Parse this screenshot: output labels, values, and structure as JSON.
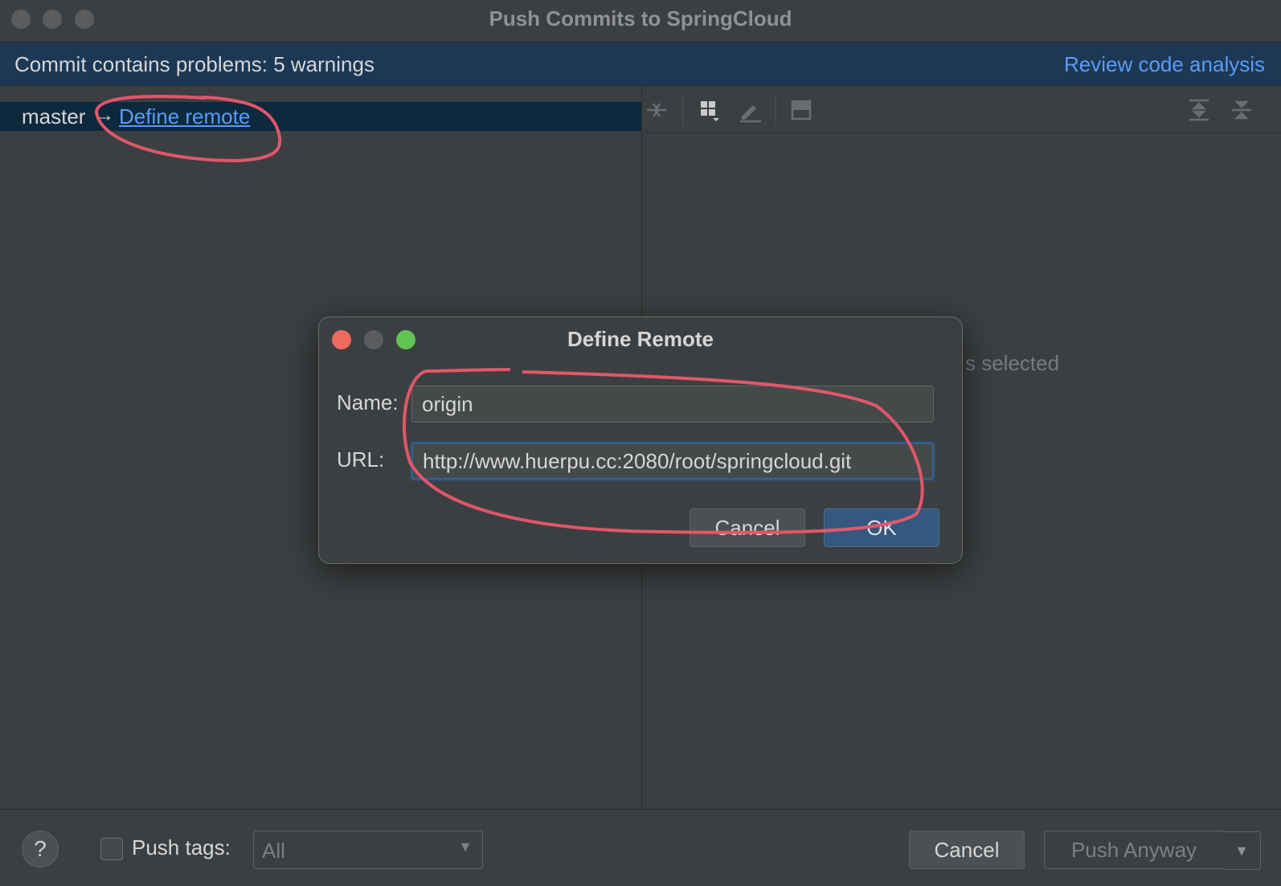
{
  "window": {
    "title": "Push Commits to SpringCloud"
  },
  "warning": {
    "message": "Commit contains problems: 5 warnings",
    "link": "Review code analysis"
  },
  "branch": {
    "name": "master",
    "arrow": "→",
    "define_remote": "Define remote"
  },
  "right_pane": {
    "empty_text_visible": "s selected"
  },
  "bottom": {
    "help": "?",
    "push_tags_label": "Push tags:",
    "push_tags_checked": false,
    "tags_value": "All",
    "cancel": "Cancel",
    "push_anyway": "Push Anyway"
  },
  "dialog": {
    "title": "Define Remote",
    "name_label": "Name:",
    "name_value": "origin",
    "url_label": "URL:",
    "url_value": "http://www.huerpu.cc:2080/root/springcloud.git",
    "cancel": "Cancel",
    "ok": "OK"
  },
  "colors": {
    "link": "#589df6",
    "warning_bg": "#1d3855",
    "annotation": "#e0576a",
    "ok_button": "#365880"
  },
  "icons": [
    "collapse-icon",
    "group-by-icon",
    "edit-icon",
    "preview-icon",
    "expand-all-icon",
    "collapse-all-icon"
  ]
}
